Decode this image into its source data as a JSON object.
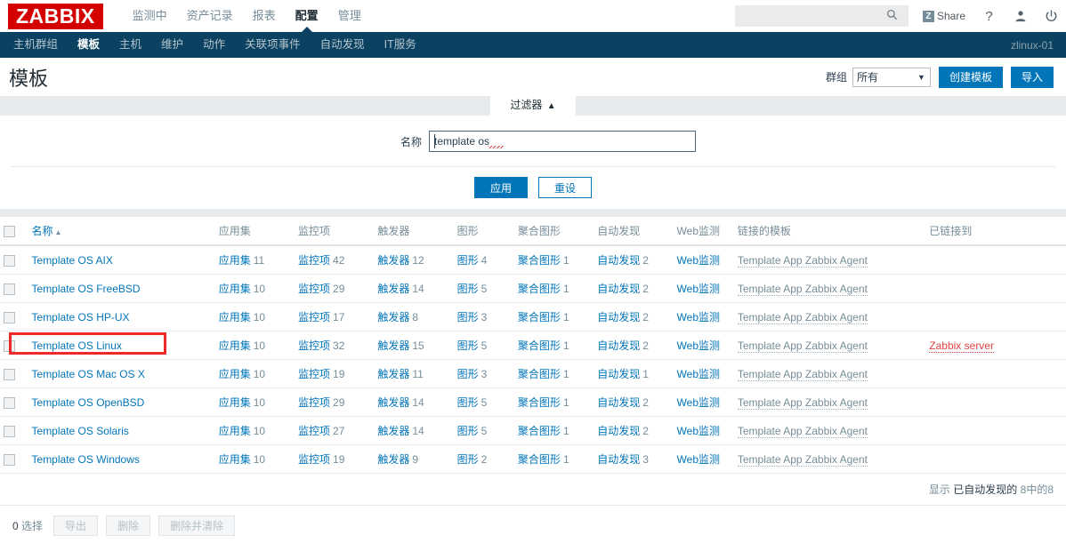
{
  "header": {
    "logo": "ZABBIX",
    "nav": [
      {
        "label": "监测中",
        "active": false
      },
      {
        "label": "资产记录",
        "active": false
      },
      {
        "label": "报表",
        "active": false
      },
      {
        "label": "配置",
        "active": true
      },
      {
        "label": "管理",
        "active": false
      }
    ],
    "search": {
      "value": "",
      "placeholder": ""
    },
    "share_label": "Share",
    "share_badge": "Z",
    "icons": {
      "search": "search-icon",
      "help": "?",
      "user": "user-icon",
      "power": "power-icon"
    }
  },
  "subnav": {
    "items": [
      {
        "label": "主机群组",
        "active": false
      },
      {
        "label": "模板",
        "active": true
      },
      {
        "label": "主机",
        "active": false
      },
      {
        "label": "维护",
        "active": false
      },
      {
        "label": "动作",
        "active": false
      },
      {
        "label": "关联项事件",
        "active": false
      },
      {
        "label": "自动发现",
        "active": false
      },
      {
        "label": "IT服务",
        "active": false
      }
    ],
    "server_name": "zlinux-01"
  },
  "page": {
    "title": "模板",
    "group_label": "群组",
    "group_value": "所有",
    "create_button": "创建模板",
    "import_button": "导入"
  },
  "filter": {
    "tab_label": "过滤器",
    "tab_caret": "▲",
    "name_label": "名称",
    "name_value": "template os",
    "name_placeholder": "",
    "apply_button": "应用",
    "reset_button": "重设"
  },
  "table": {
    "columns": {
      "name": "名称",
      "applications": "应用集",
      "items": "监控项",
      "triggers": "触发器",
      "graphs": "图形",
      "screens": "聚合图形",
      "discovery": "自动发现",
      "web": "Web监测",
      "linked_templates": "链接的模板",
      "linked_to": "已链接到"
    },
    "sort_arrow": "▲",
    "rows": [
      {
        "name": "Template OS AIX",
        "applications": "11",
        "items": "42",
        "triggers": "12",
        "graphs": "4",
        "screens": "1",
        "discovery": "2",
        "web": "",
        "linked_templates": "Template App Zabbix Agent",
        "linked_to": "",
        "highlighted": false
      },
      {
        "name": "Template OS FreeBSD",
        "applications": "10",
        "items": "29",
        "triggers": "14",
        "graphs": "5",
        "screens": "1",
        "discovery": "2",
        "web": "",
        "linked_templates": "Template App Zabbix Agent",
        "linked_to": "",
        "highlighted": false
      },
      {
        "name": "Template OS HP-UX",
        "applications": "10",
        "items": "17",
        "triggers": "8",
        "graphs": "3",
        "screens": "1",
        "discovery": "2",
        "web": "",
        "linked_templates": "Template App Zabbix Agent",
        "linked_to": "",
        "highlighted": false
      },
      {
        "name": "Template OS Linux",
        "applications": "10",
        "items": "32",
        "triggers": "15",
        "graphs": "5",
        "screens": "1",
        "discovery": "2",
        "web": "",
        "linked_templates": "Template App Zabbix Agent",
        "linked_to": "Zabbix server",
        "highlighted": true
      },
      {
        "name": "Template OS Mac OS X",
        "applications": "10",
        "items": "19",
        "triggers": "11",
        "graphs": "3",
        "screens": "1",
        "discovery": "1",
        "web": "",
        "linked_templates": "Template App Zabbix Agent",
        "linked_to": "",
        "highlighted": false
      },
      {
        "name": "Template OS OpenBSD",
        "applications": "10",
        "items": "29",
        "triggers": "14",
        "graphs": "5",
        "screens": "1",
        "discovery": "2",
        "web": "",
        "linked_templates": "Template App Zabbix Agent",
        "linked_to": "",
        "highlighted": false
      },
      {
        "name": "Template OS Solaris",
        "applications": "10",
        "items": "27",
        "triggers": "14",
        "graphs": "5",
        "screens": "1",
        "discovery": "2",
        "web": "",
        "linked_templates": "Template App Zabbix Agent",
        "linked_to": "",
        "highlighted": false
      },
      {
        "name": "Template OS Windows",
        "applications": "10",
        "items": "19",
        "triggers": "9",
        "graphs": "2",
        "screens": "1",
        "discovery": "3",
        "web": "",
        "linked_templates": "Template App Zabbix Agent",
        "linked_to": "",
        "highlighted": false
      }
    ],
    "footer_prefix": "显示",
    "footer_mid": "已自动发现的",
    "footer_count": "8中的8"
  },
  "bottom": {
    "selected_count": "0",
    "selected_label": "选择",
    "export_button": "导出",
    "delete_button": "删除",
    "delete_clear_button": "删除并清除"
  },
  "colors": {
    "brand_red": "#d40000",
    "nav_dark": "#0b4261",
    "link_blue": "#0275b8",
    "alert_red": "#e04343",
    "highlight_box": "#ef2929"
  }
}
